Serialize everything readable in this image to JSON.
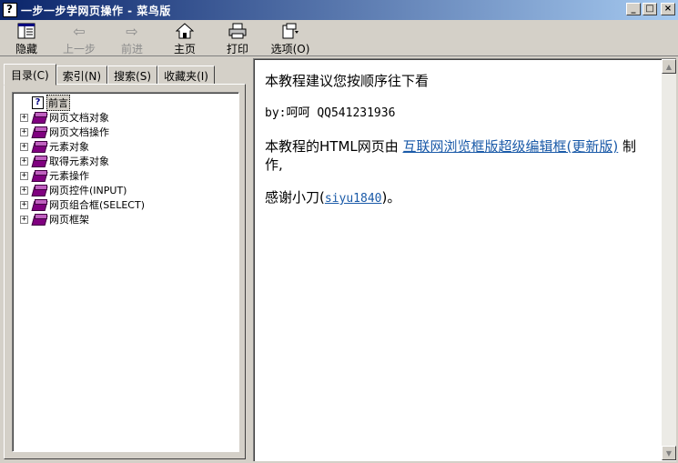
{
  "window": {
    "title": "一步一步学网页操作 - 菜鸟版"
  },
  "toolbar": {
    "hide": "隐藏",
    "back": "上一步",
    "forward": "前进",
    "home": "主页",
    "print": "打印",
    "options": "选项(O)"
  },
  "tabs": [
    "目录(C)",
    "索引(N)",
    "搜索(S)",
    "收藏夹(I)"
  ],
  "tree": {
    "preface": "前言",
    "items": [
      "网页文档对象",
      "网页文档操作",
      "元素对象",
      "取得元素对象",
      "元素操作",
      "网页控件(INPUT)",
      "网页组合框(SELECT)",
      "网页框架"
    ]
  },
  "content": {
    "line1": "本教程建议您按顺序往下看",
    "by_prefix": "by:呵呵 ",
    "qq": "QQ541231936",
    "made_prefix": "本教程的HTML网页由 ",
    "made_link": "互联网浏览框版超级编辑框(更新版)",
    "made_suffix": " 制作,",
    "thanks_prefix": "感谢小刀(",
    "thanks_link": "siyu1840",
    "thanks_suffix": ")。"
  }
}
